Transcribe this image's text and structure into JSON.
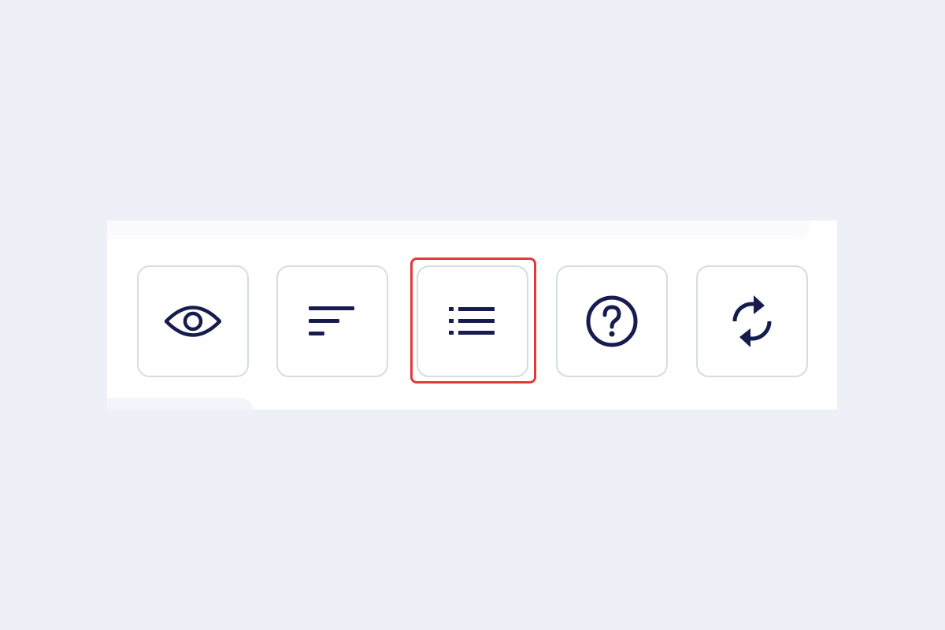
{
  "colors": {
    "page_background": "#edf0f7",
    "panel_background": "#ffffff",
    "button_border": "#d7dbe3",
    "icon": "#161c4e",
    "highlight": "#e03a3a"
  },
  "toolbar": {
    "buttons": [
      {
        "icon": "eye-icon",
        "state": "default"
      },
      {
        "icon": "sort-lines-icon",
        "state": "default"
      },
      {
        "icon": "list-icon",
        "state": "highlighted"
      },
      {
        "icon": "help-circle-icon",
        "state": "default"
      },
      {
        "icon": "refresh-icon",
        "state": "default"
      }
    ],
    "highlighted_index": 2
  }
}
